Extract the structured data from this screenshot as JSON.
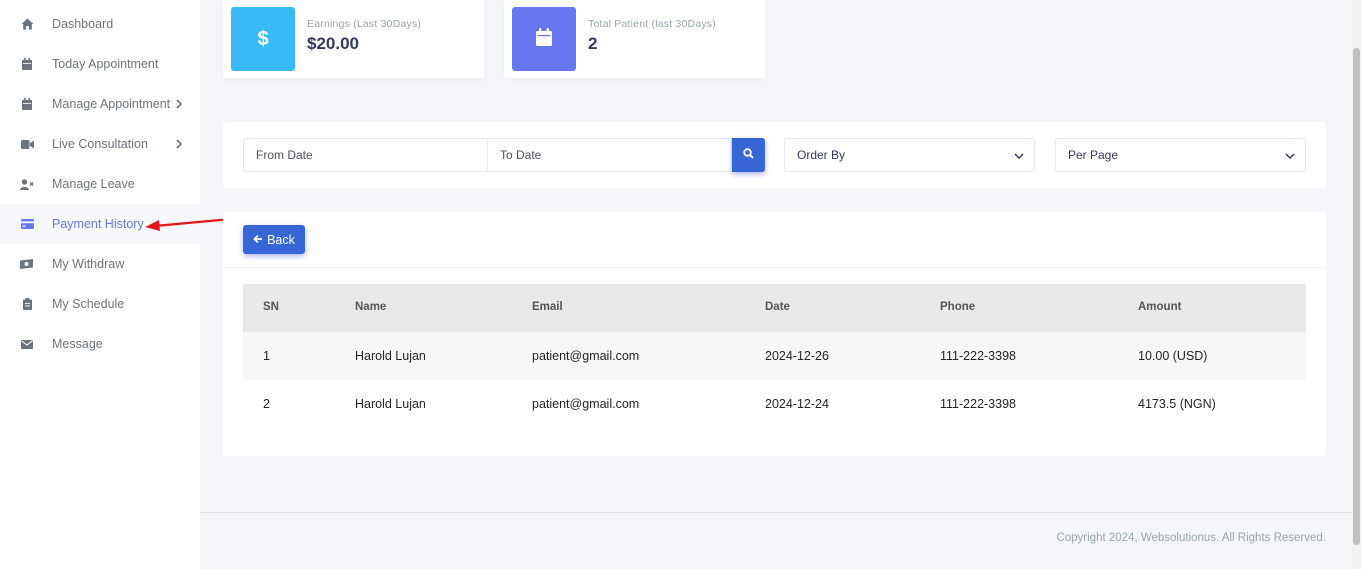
{
  "sidebar": {
    "items": [
      {
        "label": "Dashboard",
        "icon": "home-icon"
      },
      {
        "label": "Today Appointment",
        "icon": "calendar-icon"
      },
      {
        "label": "Manage Appointment",
        "icon": "calendar-icon"
      },
      {
        "label": "Live Consultation",
        "icon": "video-icon"
      },
      {
        "label": "Manage Leave",
        "icon": "user-times-icon"
      },
      {
        "label": "Payment History",
        "icon": "credit-card-icon"
      },
      {
        "label": "My Withdraw",
        "icon": "money-icon"
      },
      {
        "label": "My Schedule",
        "icon": "clipboard-icon"
      },
      {
        "label": "Message",
        "icon": "envelope-icon"
      }
    ],
    "active_color": "#6777ef"
  },
  "stats": {
    "earnings": {
      "title": "Earnings (Last 30Days)",
      "value": "$20.00",
      "color": "#3abaf4",
      "icon": "dollar-icon"
    },
    "patients": {
      "title": "Total Patient (last 30Days)",
      "value": "2",
      "color": "#6777ef",
      "icon": "calendar-icon"
    }
  },
  "filters": {
    "from_date_placeholder": "From Date",
    "to_date_placeholder": "To Date",
    "order_by": "Order By",
    "per_page": "Per Page"
  },
  "table": {
    "back_label": "Back",
    "headers": [
      "SN",
      "Name",
      "Email",
      "Date",
      "Phone",
      "Amount"
    ],
    "rows": [
      [
        "1",
        "Harold Lujan",
        "patient@gmail.com",
        "2024-12-26",
        "111-222-3398",
        "10.00 (USD)"
      ],
      [
        "2",
        "Harold Lujan",
        "patient@gmail.com",
        "2024-12-24",
        "111-222-3398",
        "4173.5 (NGN)"
      ]
    ]
  },
  "footer": {
    "copyright": "Copyright 2024, Websolutionus. All Rights Reserved."
  },
  "colors": {
    "primary": "#3866d6",
    "arrow": "#e3161c"
  }
}
